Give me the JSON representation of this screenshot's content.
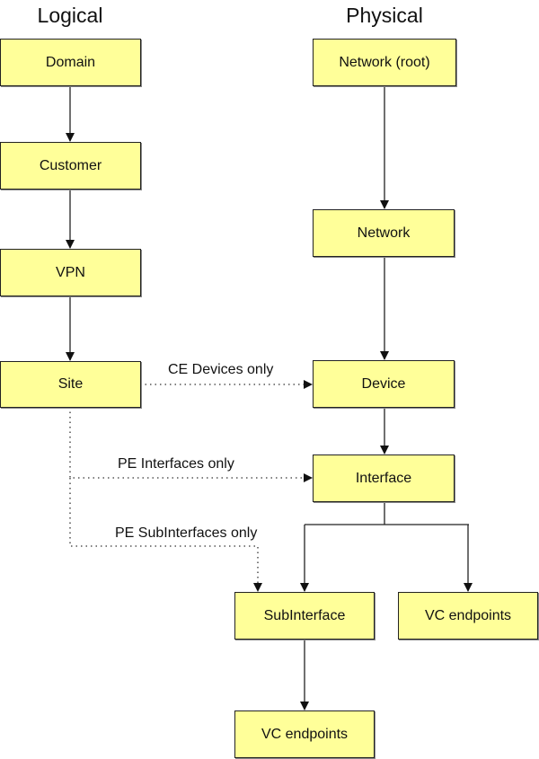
{
  "headings": {
    "logical": "Logical",
    "physical": "Physical"
  },
  "nodes": {
    "domain": "Domain",
    "customer": "Customer",
    "vpn": "VPN",
    "site": "Site",
    "network_root": "Network (root)",
    "network": "Network",
    "device": "Device",
    "interface": "Interface",
    "subinterface": "SubInterface",
    "vc_endpoints_right": "VC endpoints",
    "vc_endpoints_bottom": "VC endpoints"
  },
  "edge_labels": {
    "ce_devices": "CE Devices only",
    "pe_interfaces": "PE Interfaces only",
    "pe_subinterfaces": "PE SubInterfaces only"
  },
  "colors": {
    "box_fill": "#ffff99",
    "box_border": "#222222",
    "line": "#222222"
  }
}
